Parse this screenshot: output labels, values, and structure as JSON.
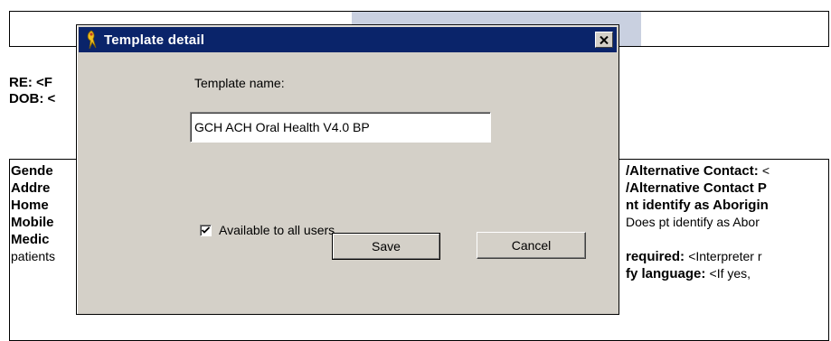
{
  "document": {
    "re_text": "RE: <F",
    "dob_text": "DOB: <",
    "left_labels": [
      "Gende",
      "Addre",
      "Home",
      "Mobile",
      "Medic"
    ],
    "left_normal": "patients",
    "right_lines": [
      {
        "bold": "/Alternative Contact: ",
        "normal": "<"
      },
      {
        "bold": "/Alternative Contact P",
        "normal": ""
      },
      {
        "bold": "nt identify as Aborigin",
        "normal": ""
      },
      {
        "bold": "",
        "normal": "Does pt identify as Abor"
      },
      {
        "bold": "",
        "normal": ""
      },
      {
        "bold": "required: ",
        "normal": "<Interpreter r"
      },
      {
        "bold": "fy language: ",
        "normal": "<If yes,"
      }
    ]
  },
  "dialog": {
    "title": "Template detail",
    "close_symbol": "✕",
    "template_name_label": "Template name:",
    "template_name_value": "GCH ACH Oral Health V4.0 BP",
    "available_label": "Available to all users",
    "available_checked": true,
    "save_label": "Save",
    "cancel_label": "Cancel",
    "title_color": "#0a246a"
  },
  "icons": {
    "title_icon": "app-icon",
    "close_icon": "close-icon",
    "check_icon": "checkmark-icon"
  }
}
